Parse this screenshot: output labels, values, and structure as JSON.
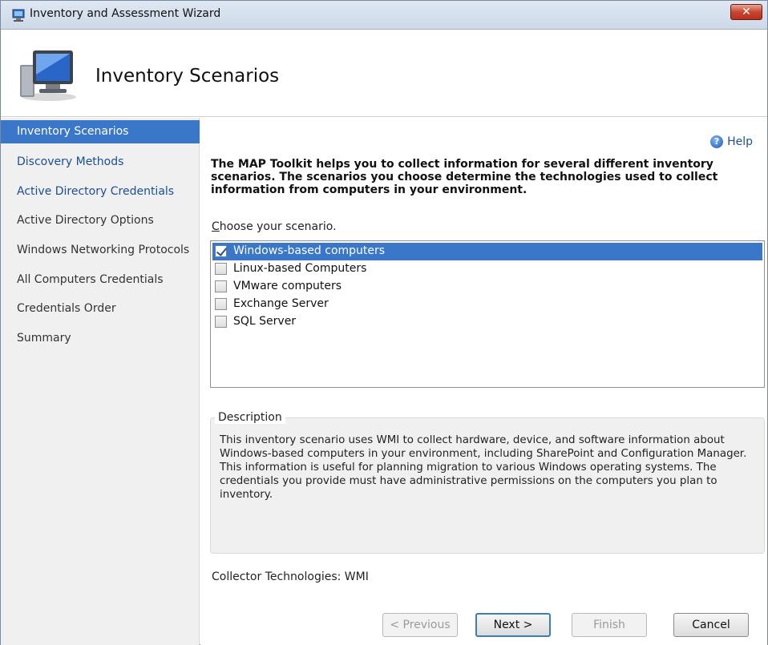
{
  "window": {
    "title": "Inventory and Assessment Wizard",
    "close_label": "✕"
  },
  "header": {
    "title": "Inventory Scenarios"
  },
  "nav": {
    "items": [
      {
        "label": "Inventory Scenarios",
        "state": "active"
      },
      {
        "label": "Discovery Methods",
        "state": "link"
      },
      {
        "label": "Active Directory Credentials",
        "state": "link"
      },
      {
        "label": "Active Directory Options",
        "state": "normal"
      },
      {
        "label": "Windows Networking Protocols",
        "state": "normal"
      },
      {
        "label": "All Computers Credentials",
        "state": "normal"
      },
      {
        "label": "Credentials Order",
        "state": "normal"
      },
      {
        "label": "Summary",
        "state": "normal"
      }
    ]
  },
  "main": {
    "help_label": "Help",
    "intro": "The MAP Toolkit helps you to collect information for several different inventory scenarios. The scenarios you choose determine the technologies used to collect information from computers in your environment.",
    "choose_label_first": "C",
    "choose_label_rest": "hoose your scenario.",
    "scenarios": [
      {
        "label": "Windows-based computers",
        "checked": true,
        "selected": true
      },
      {
        "label": "Linux-based Computers",
        "checked": false,
        "selected": false
      },
      {
        "label": "VMware computers",
        "checked": false,
        "selected": false
      },
      {
        "label": "Exchange Server",
        "checked": false,
        "selected": false
      },
      {
        "label": "SQL Server",
        "checked": false,
        "selected": false
      }
    ],
    "description_title": "Description",
    "description_text": "This inventory scenario uses WMI to collect hardware, device, and software information about Windows-based computers in your environment, including SharePoint and Configuration Manager. This information is useful for planning migration to various Windows operating systems. The credentials you provide must have administrative permissions on the computers you plan to inventory.",
    "collector": "Collector Technologies: WMI"
  },
  "buttons": {
    "previous": "< Previous",
    "next": "Next >",
    "finish": "Finish",
    "cancel": "Cancel"
  },
  "colors": {
    "selection": "#3a77c9",
    "link": "#1b4f93"
  }
}
